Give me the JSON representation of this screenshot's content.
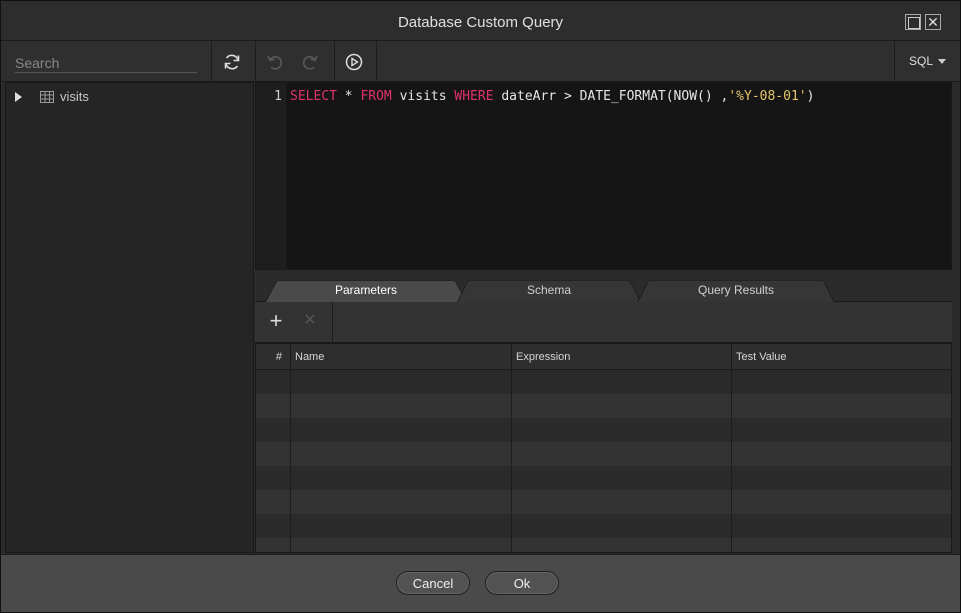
{
  "window": {
    "title": "Database Custom Query",
    "close_glyph": "✕"
  },
  "toolbar": {
    "search_placeholder": "Search",
    "icons": [
      "refresh-icon",
      "undo-icon",
      "redo-icon",
      "run-icon"
    ],
    "language": "SQL"
  },
  "sidebar": {
    "items": [
      {
        "label": "visits",
        "icon": "table-icon"
      }
    ]
  },
  "editor": {
    "line_number": "1",
    "tokens": {
      "k1": "SELECT",
      "t1": " * ",
      "k2": "FROM",
      "t2": " visits ",
      "k3": "WHERE",
      "t3": " dateArr > DATE_FORMAT(NOW() ,",
      "s1": "'%Y-08-01'",
      "t4": ")"
    }
  },
  "tabs": [
    {
      "label": "Parameters",
      "active": true
    },
    {
      "label": "Schema",
      "active": false
    },
    {
      "label": "Query Results",
      "active": false
    }
  ],
  "params_toolbar": {
    "add_glyph": "+",
    "remove_glyph": "✕"
  },
  "grid": {
    "columns": [
      "#",
      "Name",
      "Expression",
      "Test Value"
    ]
  },
  "footer": {
    "cancel_label": "Cancel",
    "ok_label": "Ok"
  },
  "colors": {
    "keyword": "#e0326b",
    "string": "#e3c56a",
    "background": "#2b2b2b"
  }
}
